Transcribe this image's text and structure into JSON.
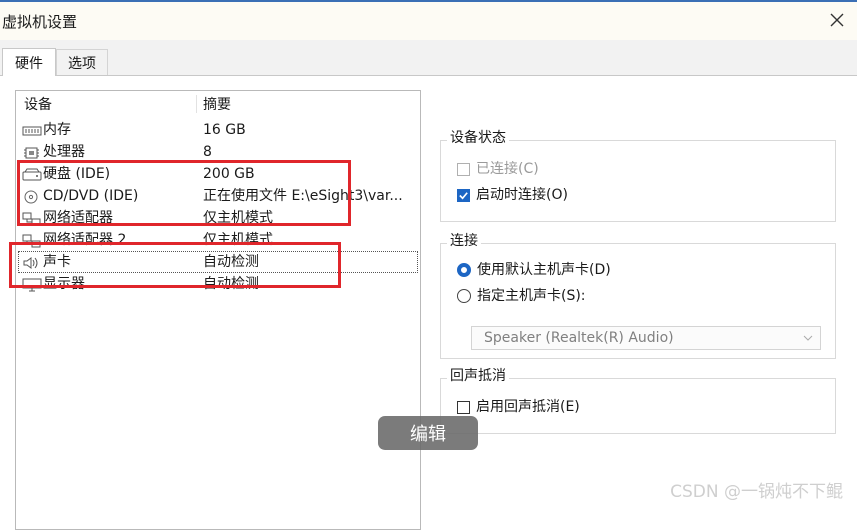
{
  "window": {
    "title": "虚拟机设置",
    "close_icon": "close-icon"
  },
  "tabs": [
    {
      "label": "硬件",
      "active": true
    },
    {
      "label": "选项",
      "active": false
    }
  ],
  "device_list": {
    "columns": [
      "设备",
      "摘要"
    ],
    "rows": [
      {
        "name": "内存",
        "summary": "16 GB",
        "icon": "memory-icon"
      },
      {
        "name": "处理器",
        "summary": "8",
        "icon": "processor-icon"
      },
      {
        "name": "硬盘 (IDE)",
        "summary": "200 GB",
        "icon": "hard-disk-icon"
      },
      {
        "name": "CD/DVD (IDE)",
        "summary": "正在使用文件 E:\\eSight3\\var...",
        "icon": "cd-dvd-icon"
      },
      {
        "name": "网络适配器",
        "summary": "仅主机模式",
        "icon": "network-adapter-icon"
      },
      {
        "name": "网络适配器 2",
        "summary": "仅主机模式",
        "icon": "network-adapter-icon"
      },
      {
        "name": "声卡",
        "summary": "自动检测",
        "icon": "speaker-icon"
      },
      {
        "name": "显示器",
        "summary": "自动检测",
        "icon": "monitor-icon"
      }
    ]
  },
  "device_status": {
    "title": "设备状态",
    "connected": {
      "label": "已连接(C)",
      "checked": false,
      "disabled": true
    },
    "connect_at_power_on": {
      "label": "启动时连接(O)",
      "checked": true
    }
  },
  "connection": {
    "title": "连接",
    "use_default": {
      "label": "使用默认主机声卡(D)",
      "selected": true
    },
    "specify": {
      "label": "指定主机声卡(S):",
      "selected": false
    },
    "select_value": "Speaker (Realtek(R) Audio)"
  },
  "echo_cancel": {
    "title": "回声抵消",
    "enable": {
      "label": "启用回声抵消(E)",
      "checked": false
    }
  },
  "overlay": {
    "edit_label": "编辑"
  },
  "watermark": "CSDN @一锅炖不下鲲",
  "colors": {
    "accent": "#1d66c4",
    "highlight_box": "#e0262b",
    "title_border": "#3b6fb5"
  }
}
